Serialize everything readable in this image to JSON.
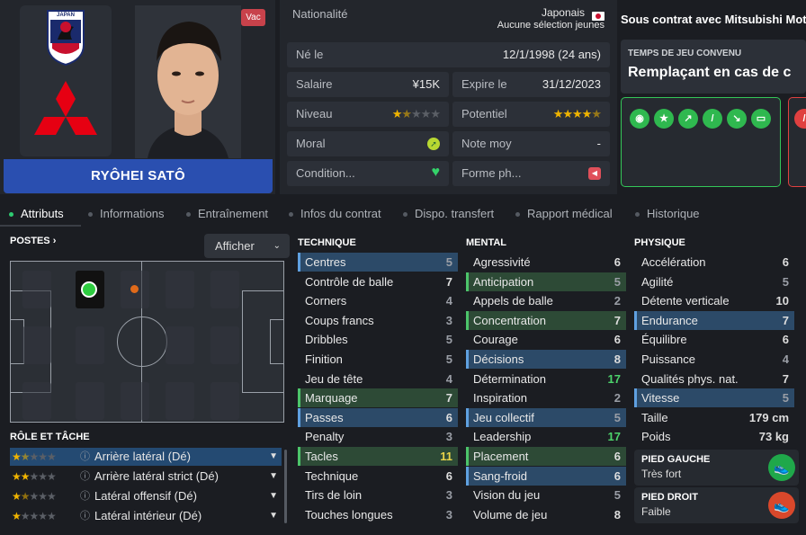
{
  "profile": {
    "badge_text": "JAPAN",
    "vac_label": "Vac",
    "player_name": "RYÔHEI SATÔ"
  },
  "info": {
    "nationality_label": "Nationalité",
    "nationality_value": "Japonais",
    "nationality_sub": "Aucune sélection jeunes",
    "born_label": "Né le",
    "born_value": "12/1/1998 (24 ans)",
    "salary_label": "Salaire",
    "salary_value": "¥15K",
    "expires_label": "Expire le",
    "expires_value": "31/12/2023",
    "level_label": "Niveau",
    "level_stars": 1.5,
    "potential_label": "Potentiel",
    "potential_stars": 4.5,
    "morale_label": "Moral",
    "rating_label": "Note moy",
    "rating_value": "-",
    "condition_label": "Condition...",
    "form_label": "Forme ph..."
  },
  "contract": {
    "title": "Sous contrat avec Mitsubishi Moto",
    "playing_time_label": "TEMPS DE JEU CONVENU",
    "playing_time_value": "Remplaçant en cas de c"
  },
  "tabs": [
    {
      "label": "Attributs"
    },
    {
      "label": "Informations"
    },
    {
      "label": "Entraînement"
    },
    {
      "label": "Infos du contrat"
    },
    {
      "label": "Dispo. transfert"
    },
    {
      "label": "Rapport médical"
    },
    {
      "label": "Historique"
    }
  ],
  "positions": {
    "title": "POSTES",
    "chevron": "›",
    "display_button": "Afficher"
  },
  "roles": {
    "title": "RÔLE ET TÂCHE",
    "items": [
      {
        "label": "Arrière latéral (Dé)",
        "stars": 1.5
      },
      {
        "label": "Arrière latéral strict (Dé)",
        "stars": 2
      },
      {
        "label": "Latéral offensif (Dé)",
        "stars": 1.5
      },
      {
        "label": "Latéral intérieur (Dé)",
        "stars": 1
      }
    ]
  },
  "attributes": {
    "technique_title": "TECHNIQUE",
    "mental_title": "MENTAL",
    "physique_title": "PHYSIQUE",
    "technique": [
      {
        "name": "Centres",
        "value": "5",
        "hl": "blue"
      },
      {
        "name": "Contrôle de balle",
        "value": "7",
        "hl": ""
      },
      {
        "name": "Corners",
        "value": "4",
        "hl": ""
      },
      {
        "name": "Coups francs",
        "value": "3",
        "hl": ""
      },
      {
        "name": "Dribbles",
        "value": "5",
        "hl": ""
      },
      {
        "name": "Finition",
        "value": "5",
        "hl": ""
      },
      {
        "name": "Jeu de tête",
        "value": "4",
        "hl": ""
      },
      {
        "name": "Marquage",
        "value": "7",
        "hl": "green"
      },
      {
        "name": "Passes",
        "value": "6",
        "hl": "blue"
      },
      {
        "name": "Penalty",
        "value": "3",
        "hl": ""
      },
      {
        "name": "Tacles",
        "value": "11",
        "hl": "green"
      },
      {
        "name": "Technique",
        "value": "6",
        "hl": ""
      },
      {
        "name": "Tirs de loin",
        "value": "3",
        "hl": ""
      },
      {
        "name": "Touches longues",
        "value": "3",
        "hl": ""
      }
    ],
    "mental": [
      {
        "name": "Agressivité",
        "value": "6",
        "hl": ""
      },
      {
        "name": "Anticipation",
        "value": "5",
        "hl": "green"
      },
      {
        "name": "Appels de balle",
        "value": "2",
        "hl": ""
      },
      {
        "name": "Concentration",
        "value": "7",
        "hl": "green"
      },
      {
        "name": "Courage",
        "value": "6",
        "hl": ""
      },
      {
        "name": "Décisions",
        "value": "8",
        "hl": "blue"
      },
      {
        "name": "Détermination",
        "value": "17",
        "hl": ""
      },
      {
        "name": "Inspiration",
        "value": "2",
        "hl": ""
      },
      {
        "name": "Jeu collectif",
        "value": "5",
        "hl": "blue"
      },
      {
        "name": "Leadership",
        "value": "17",
        "hl": ""
      },
      {
        "name": "Placement",
        "value": "6",
        "hl": "green"
      },
      {
        "name": "Sang-froid",
        "value": "6",
        "hl": "blue"
      },
      {
        "name": "Vision du jeu",
        "value": "5",
        "hl": ""
      },
      {
        "name": "Volume de jeu",
        "value": "8",
        "hl": ""
      }
    ],
    "physique": [
      {
        "name": "Accélération",
        "value": "6",
        "hl": ""
      },
      {
        "name": "Agilité",
        "value": "5",
        "hl": ""
      },
      {
        "name": "Détente verticale",
        "value": "10",
        "hl": ""
      },
      {
        "name": "Endurance",
        "value": "7",
        "hl": "blue"
      },
      {
        "name": "Équilibre",
        "value": "6",
        "hl": ""
      },
      {
        "name": "Puissance",
        "value": "4",
        "hl": ""
      },
      {
        "name": "Qualités phys. nat.",
        "value": "7",
        "hl": ""
      },
      {
        "name": "Vitesse",
        "value": "5",
        "hl": "blue"
      },
      {
        "name": "Taille",
        "value": "179 cm",
        "hl": ""
      },
      {
        "name": "Poids",
        "value": "73 kg",
        "hl": ""
      }
    ],
    "left_foot_title": "PIED GAUCHE",
    "left_foot_value": "Très fort",
    "right_foot_title": "PIED DROIT",
    "right_foot_value": "Faible"
  },
  "colors": {
    "accent_blue": "#2a4fb0",
    "good_green": "#34c759",
    "bad_red": "#e04040"
  }
}
